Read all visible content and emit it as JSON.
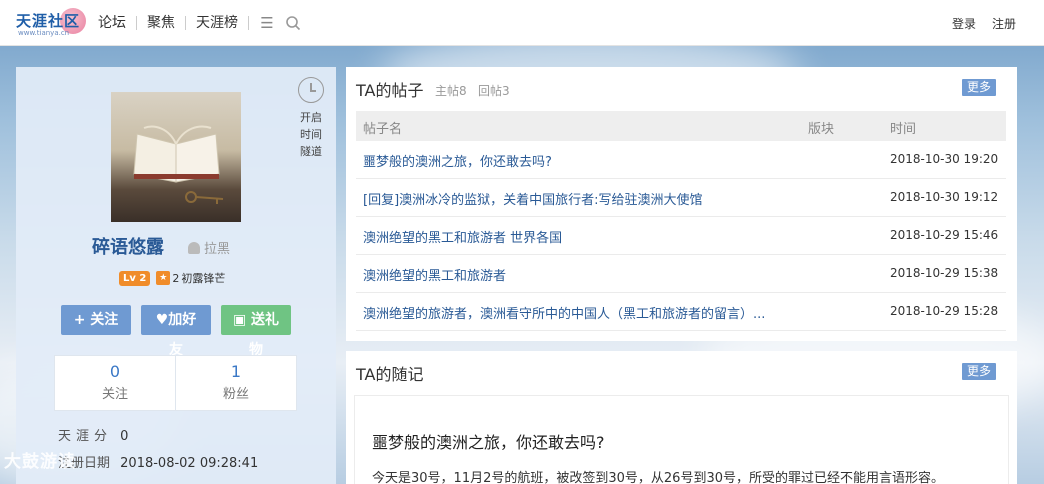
{
  "brand": {
    "name": "天涯社区",
    "sub": "www.tianya.cn"
  },
  "nav": {
    "items": [
      {
        "label": "论坛"
      },
      {
        "label": "聚焦"
      },
      {
        "label": "天涯榜"
      }
    ],
    "login": "登录",
    "register": "注册"
  },
  "profile": {
    "username": "碎语悠露",
    "block_label": "拉黑",
    "tunnel": [
      "开启",
      "时间",
      "隧道"
    ],
    "level": "Lv 2",
    "rank_num": "2",
    "rank_title": "初露锋芒",
    "buttons": {
      "follow": "+ 关注",
      "add_friend": "加好友",
      "gift": "送礼物"
    },
    "stats": [
      {
        "value": "0",
        "label": "关注"
      },
      {
        "value": "1",
        "label": "粉丝"
      }
    ],
    "tianya_score_label": "天涯分",
    "tianya_score": "0",
    "register_date_label": "注册日期",
    "register_date": "2018-08-02 09:28:41"
  },
  "posts_panel": {
    "title": "TA的帖子",
    "main_count": "主帖8",
    "reply_count": "回帖3",
    "more": "更多",
    "columns": {
      "name": "帖子名",
      "board": "版块",
      "time": "时间"
    },
    "rows": [
      {
        "title": "噩梦般的澳洲之旅，你还敢去吗?",
        "time": "2018-10-30 19:20"
      },
      {
        "title": "[回复]澳洲冰冷的监狱，关着中国旅行者:写给驻澳洲大使馆",
        "time": "2018-10-30 19:12"
      },
      {
        "title": "澳洲绝望的黑工和旅游者 世界各国",
        "time": "2018-10-29 15:46"
      },
      {
        "title": "澳洲绝望的黑工和旅游者",
        "time": "2018-10-29 15:38"
      },
      {
        "title": "澳洲绝望的旅游者，澳洲看守所中的中国人（黑工和旅游者的留言）...",
        "time": "2018-10-29 15:28"
      }
    ]
  },
  "notes_panel": {
    "title": "TA的随记",
    "more": "更多",
    "note_title": "噩梦般的澳洲之旅，你还敢去吗?",
    "note_body": "今天是30号，11月2号的航班，被改签到30号，从26号到30号，所受的罪过已经不能用言语形容。"
  },
  "watermark": "大鼓游读"
}
